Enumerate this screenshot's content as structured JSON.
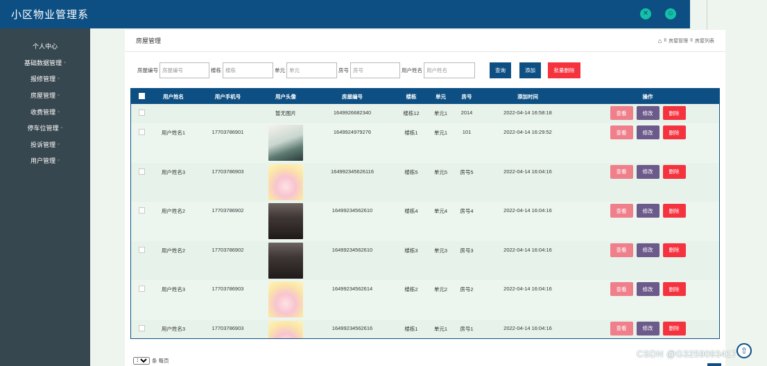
{
  "app": {
    "title": "小区物业管理系",
    "icons": [
      "shrink-icon",
      "user-icon"
    ]
  },
  "sidebar": {
    "items": [
      {
        "label": "个人中心",
        "has_arrow": false
      },
      {
        "label": "基础数据管理",
        "has_arrow": true
      },
      {
        "label": "报修管理",
        "has_arrow": true
      },
      {
        "label": "房屋管理",
        "has_arrow": true
      },
      {
        "label": "收费管理",
        "has_arrow": true
      },
      {
        "label": "停车位管理",
        "has_arrow": true
      },
      {
        "label": "投诉管理",
        "has_arrow": true
      },
      {
        "label": "用户管理",
        "has_arrow": true
      }
    ]
  },
  "page": {
    "title": "房屋管理",
    "breadcrumb": [
      "房屋管理",
      "房屋列表"
    ],
    "breadcrumb_sep": "II"
  },
  "search": {
    "house_no_label": "房屋编号",
    "house_no_placeholder": "房屋编号",
    "building_label": "楼栋",
    "building_placeholder": "楼栋",
    "unit_label": "单元",
    "unit_placeholder": "单元",
    "room_label": "房号",
    "room_placeholder": "房号",
    "user_label": "用户姓名",
    "user_placeholder": "用户姓名",
    "query_button": "查询",
    "add_button": "添加",
    "batch_delete_button": "批量删除"
  },
  "table": {
    "columns": [
      "用户姓名",
      "用户手机号",
      "用户头像",
      "房屋编号",
      "楼栋",
      "单元",
      "房号",
      "添加时间",
      "操作"
    ],
    "actions": {
      "view": "查看",
      "edit": "修改",
      "delete": "删除"
    },
    "rows": [
      {
        "name": "",
        "phone": "",
        "avatar": "暂无图片",
        "avatar_type": "none",
        "house_no": "1649926682340",
        "building": "楼栋12",
        "unit": "单元1",
        "room": "2014",
        "time": "2022-04-14 16:58:18"
      },
      {
        "name": "用户姓名1",
        "phone": "17703786901",
        "avatar": "",
        "avatar_type": "green",
        "house_no": "1649924979276",
        "building": "楼栋1",
        "unit": "单元1",
        "room": "101",
        "time": "2022-04-14 16:29:52"
      },
      {
        "name": "用户姓名3",
        "phone": "17703786903",
        "avatar": "",
        "avatar_type": "anime",
        "house_no": "164992345626116",
        "building": "楼栋5",
        "unit": "单元5",
        "room": "房号5",
        "time": "2022-04-14 16:04:16"
      },
      {
        "name": "用户姓名2",
        "phone": "17703786902",
        "avatar": "",
        "avatar_type": "dark",
        "house_no": "16499234562610",
        "building": "楼栋4",
        "unit": "单元4",
        "room": "房号4",
        "time": "2022-04-14 16:04:16"
      },
      {
        "name": "用户姓名2",
        "phone": "17703786902",
        "avatar": "",
        "avatar_type": "dark",
        "house_no": "16499234562610",
        "building": "楼栋3",
        "unit": "单元3",
        "room": "房号3",
        "time": "2022-04-14 16:04:16"
      },
      {
        "name": "用户姓名3",
        "phone": "17703786903",
        "avatar": "",
        "avatar_type": "anime",
        "house_no": "16499234562614",
        "building": "楼栋2",
        "unit": "单元2",
        "room": "房号2",
        "time": "2022-04-14 16:04:16"
      },
      {
        "name": "用户姓名3",
        "phone": "17703786903",
        "avatar": "",
        "avatar_type": "anime",
        "house_no": "16499234562616",
        "building": "楼栋1",
        "unit": "单元1",
        "room": "房号1",
        "time": "2022-04-14 16:04:16"
      }
    ]
  },
  "pager": {
    "page_size": "10",
    "per_page_label": "条 每页"
  },
  "watermark": "CSDN @G3259093417",
  "colors": {
    "primary": "#0d4f83",
    "sidebar": "#37474f",
    "danger": "#f5333f",
    "view": "#ef7f8a",
    "edit": "#6b5a8a",
    "accent": "#14c0a6"
  }
}
